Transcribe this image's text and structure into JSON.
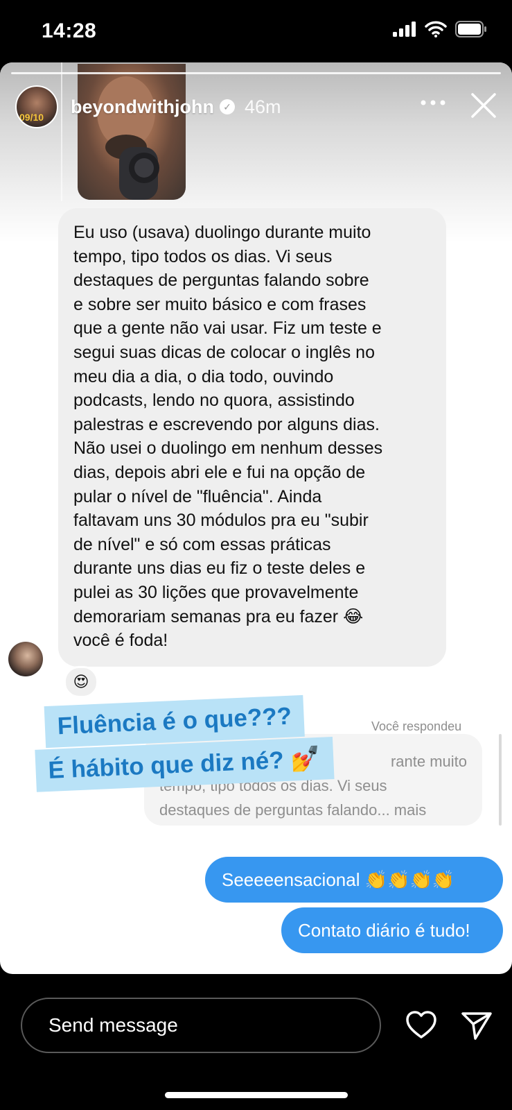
{
  "status_bar": {
    "time": "14:28"
  },
  "story": {
    "username": "beyondwithjohn",
    "time_ago": "46m",
    "avatar_badge": "09/10",
    "verified_mark": "✓"
  },
  "message": {
    "lines": [
      "Eu uso (usava) duolingo durante muito",
      "tempo, tipo todos os dias. Vi seus",
      "destaques de perguntas falando sobre",
      "e sobre ser muito básico e com frases",
      "que a gente não vai usar. Fiz um teste e",
      "segui suas dicas de colocar o inglês no",
      "meu dia a dia, o dia todo, ouvindo",
      "podcasts, lendo no quora, assistindo",
      "palestras e escrevendo por alguns dias.",
      "Não usei o duolingo em nenhum desses",
      "dias, depois abri ele e fui na opção de",
      "pular o nível de \"fluência\". Ainda",
      "faltavam uns 30 módulos pra eu \"subir",
      "de nível\" e só com essas práticas",
      "durante uns dias eu fiz o teste deles e",
      "pulei as 30 lições que provavelmente",
      "demorariam semanas pra eu fazer 😂",
      "você é foda!"
    ],
    "reaction": "😍"
  },
  "reply": {
    "label": "Você respondeu",
    "quote_lines": [
      "rante muito",
      "tempo, tipo todos os dias. Vi seus",
      "destaques de perguntas falando... mais"
    ]
  },
  "sticker": {
    "line1": "Fluência é o que???",
    "line2": "É hábito que diz né? 💅"
  },
  "outgoing": [
    {
      "text": "Seeeeensacional 👏👏👏👏"
    },
    {
      "text": "Contato diário é tudo!"
    }
  ],
  "bottom": {
    "placeholder": "Send message",
    "icons": {
      "like": "heart-icon",
      "send": "send-icon"
    }
  },
  "colors": {
    "outgoing_bubble": "#3797f0",
    "incoming_bubble": "#efefef",
    "sticker_bg": "#b9e2f7",
    "sticker_text": "#1b79c2"
  }
}
